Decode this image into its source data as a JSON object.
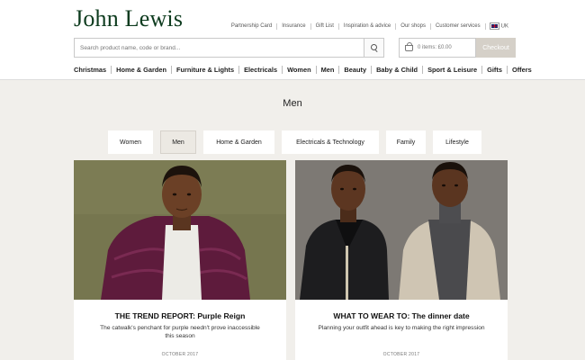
{
  "header": {
    "logo": "John Lewis",
    "utility_links": [
      "Partnership Card",
      "Insurance",
      "Gift List",
      "Inspiration & advice",
      "Our shops",
      "Customer services"
    ],
    "region": "UK",
    "search_placeholder": "Search product name, code or brand...",
    "basket_text": "0 items: £0.00",
    "checkout_label": "Checkout"
  },
  "nav": {
    "items": [
      "Christmas",
      "Home & Garden",
      "Furniture & Lights",
      "Electricals",
      "Women",
      "Men",
      "Beauty",
      "Baby & Child",
      "Sport & Leisure",
      "Gifts",
      "Offers"
    ]
  },
  "main": {
    "title": "Men",
    "tabs": [
      {
        "label": "Women",
        "active": false
      },
      {
        "label": "Men",
        "active": true
      },
      {
        "label": "Home & Garden",
        "active": false
      },
      {
        "label": "Electricals & Technology",
        "active": false
      },
      {
        "label": "Family",
        "active": false
      },
      {
        "label": "Lifestyle",
        "active": false
      }
    ],
    "cards": [
      {
        "title": "THE TREND REPORT: Purple Reign",
        "description": "The catwalk's penchant for purple needn't prove inaccessible this season",
        "date": "OCTOBER 2017"
      },
      {
        "title": "WHAT TO WEAR TO: The dinner date",
        "description": "Planning your outfit ahead is key to making the right impression",
        "date": "OCTOBER 2017"
      }
    ]
  },
  "colors": {
    "brand": "#0d3b1e",
    "page_bg": "#f1efeb",
    "checkout_bg": "#d5d0c8"
  }
}
